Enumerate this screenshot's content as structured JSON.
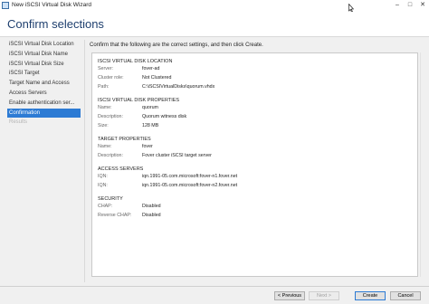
{
  "window": {
    "title": "New iSCSI Virtual Disk Wizard",
    "minimize_glyph": "–",
    "maximize_glyph": "□",
    "close_glyph": "✕"
  },
  "header": {
    "title": "Confirm selections"
  },
  "sidebar": {
    "items": [
      {
        "label": "iSCSI Virtual Disk Location",
        "state": "normal"
      },
      {
        "label": "iSCSI Virtual Disk Name",
        "state": "normal"
      },
      {
        "label": "iSCSI Virtual Disk Size",
        "state": "normal"
      },
      {
        "label": "iSCSI Target",
        "state": "normal"
      },
      {
        "label": "Target Name and Access",
        "state": "normal"
      },
      {
        "label": "Access Servers",
        "state": "normal"
      },
      {
        "label": "Enable authentication ser...",
        "state": "normal"
      },
      {
        "label": "Confirmation",
        "state": "active"
      },
      {
        "label": "Results",
        "state": "disabled"
      }
    ]
  },
  "main": {
    "intro": "Confirm that the following are the correct settings, and then click Create.",
    "location": {
      "heading": "ISCSI VIRTUAL DISK LOCATION",
      "rows": [
        {
          "key": "Server:",
          "value": "fover-ad"
        },
        {
          "key": "Cluster role:",
          "value": "Not Clustered"
        },
        {
          "key": "Path:",
          "value": "C:\\iSCSIVirtualDisks\\quorum.vhdx"
        }
      ]
    },
    "properties": {
      "heading": "ISCSI VIRTUAL DISK PROPERTIES",
      "rows": [
        {
          "key": "Name:",
          "value": "quorum"
        },
        {
          "key": "Description:",
          "value": "Quorum witness disk"
        },
        {
          "key": "Size:",
          "value": "128 MB"
        }
      ]
    },
    "target": {
      "heading": "TARGET PROPERTIES",
      "rows": [
        {
          "key": "Name:",
          "value": "fover"
        },
        {
          "key": "Description:",
          "value": "Fover cluster iSCSI target server"
        }
      ]
    },
    "access": {
      "heading": "ACCESS SERVERS",
      "rows": [
        {
          "key": "IQN:",
          "value": "iqn.1991-05.com.microsoft:fover-n1.fover.net"
        },
        {
          "key": "IQN:",
          "value": "iqn.1991-05.com.microsoft:fover-n2.fover.net"
        }
      ]
    },
    "security": {
      "heading": "SECURITY",
      "rows": [
        {
          "key": "CHAP:",
          "value": "Disabled"
        },
        {
          "key": "Reverse CHAP:",
          "value": "Disabled"
        }
      ]
    }
  },
  "footer": {
    "previous": "< Previous",
    "next": "Next >",
    "create": "Create",
    "cancel": "Cancel"
  }
}
